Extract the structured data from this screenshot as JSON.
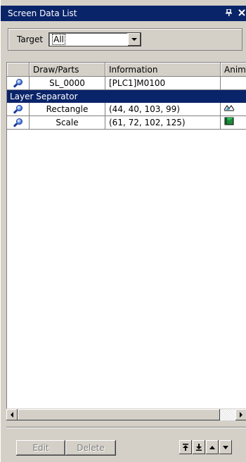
{
  "window": {
    "title": "Screen Data List",
    "pin_glyph": "ᵖ",
    "close_glyph": "✕"
  },
  "filter": {
    "label": "Target",
    "selected": "All"
  },
  "table": {
    "columns": [
      "",
      "Draw/Parts",
      "Information",
      "Animation"
    ],
    "rows": [
      {
        "kind": "item",
        "icon": "magnify-icon",
        "name": "SL_0000",
        "information": "[PLC1]M0100",
        "animation": ""
      },
      {
        "kind": "section",
        "label": "Layer Separator"
      },
      {
        "kind": "item",
        "icon": "magnify-icon",
        "name": "Rectangle",
        "information": "(44, 40, 103, 99)",
        "animation": "shape-animation-icon"
      },
      {
        "kind": "item",
        "icon": "magnify-icon",
        "name": "Scale",
        "information": "(61, 72, 102, 125)",
        "animation": "scale-animation-icon"
      }
    ]
  },
  "buttons": {
    "edit": "Edit",
    "delete": "Delete"
  },
  "nav_buttons": [
    "move-top",
    "move-bottom",
    "move-up",
    "move-down"
  ],
  "colors": {
    "titlebar": "#0a246a",
    "section_row": "#0a246a",
    "face": "#d4d0c8"
  }
}
